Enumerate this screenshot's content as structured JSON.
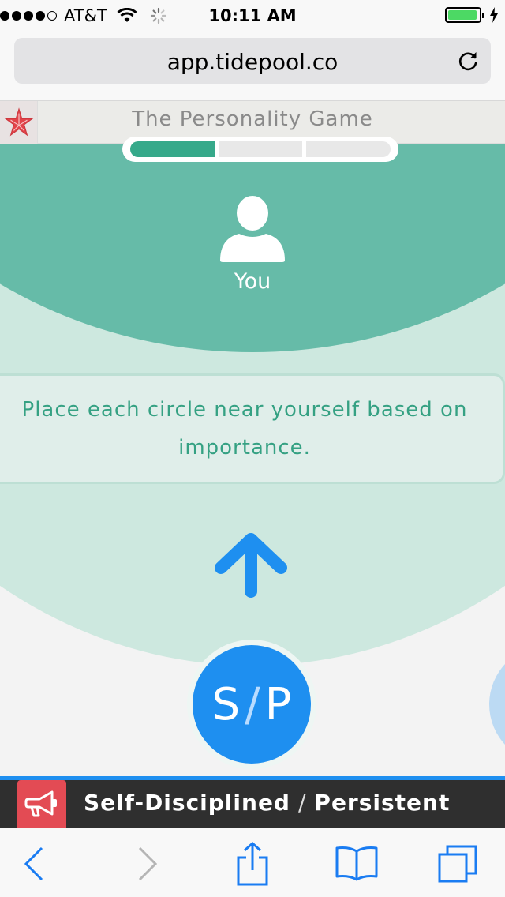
{
  "status_bar": {
    "carrier": "AT&T",
    "time": "10:11 AM",
    "signal_bars_filled": 4,
    "signal_bars_total": 5,
    "battery_level": 0.95
  },
  "browser": {
    "url": "app.tidepool.co"
  },
  "game": {
    "title": "The Personality Game",
    "progress": {
      "segments": 3,
      "completed": 1
    },
    "you_label": "You",
    "instruction": "Place each circle near yourself based on importance.",
    "current_circle": {
      "left": "S",
      "right": "P"
    }
  },
  "trait_bar": {
    "first": "Self-Disciplined",
    "separator": "/",
    "second": "Persistent"
  },
  "colors": {
    "accent_green": "#36a98a",
    "outer_ring": "#cde8df",
    "inner_ring": "#66bba8",
    "circle_blue": "#1e8ff0",
    "megaphone_red": "#e34b54",
    "ios_blue": "#1a7cf2"
  },
  "icons": [
    "star-icon",
    "person-icon",
    "arrow-up-icon",
    "megaphone-icon",
    "reload-icon",
    "back-icon",
    "forward-icon",
    "share-icon",
    "bookmarks-icon",
    "tabs-icon"
  ]
}
